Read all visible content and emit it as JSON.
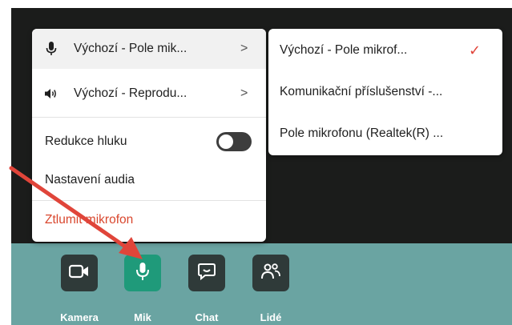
{
  "menu": {
    "items": [
      {
        "label": "Výchozí - Pole mik...",
        "icon": "microphone-icon",
        "has_submenu": true
      },
      {
        "label": "Výchozí - Reprodu...",
        "icon": "speaker-icon",
        "has_submenu": true
      },
      {
        "label": "Redukce hluku",
        "toggle_on": false
      },
      {
        "label": "Nastavení audia"
      },
      {
        "label": "Ztlumit mikrofon",
        "color": "#d9472e"
      }
    ],
    "chevron": ">"
  },
  "submenu": {
    "items": [
      {
        "label": "Výchozí - Pole mikrof...",
        "selected": true
      },
      {
        "label": "Komunikační příslušenství -..."
      },
      {
        "label": "Pole mikrofonu (Realtek(R) ..."
      }
    ],
    "check": "✓"
  },
  "toolbar": {
    "buttons": [
      {
        "label": "Kamera",
        "icon": "camera-icon"
      },
      {
        "label": "Mik",
        "icon": "microphone-icon",
        "active": true
      },
      {
        "label": "Chat",
        "icon": "chat-icon"
      },
      {
        "label": "Lidé",
        "icon": "people-icon"
      }
    ]
  },
  "colors": {
    "toolbar_bg": "#6aa4a2",
    "button_bg": "#2f3a39",
    "active_button_bg": "#1f9a7a",
    "danger": "#d9472e",
    "annotation_arrow": "#e0453a"
  }
}
